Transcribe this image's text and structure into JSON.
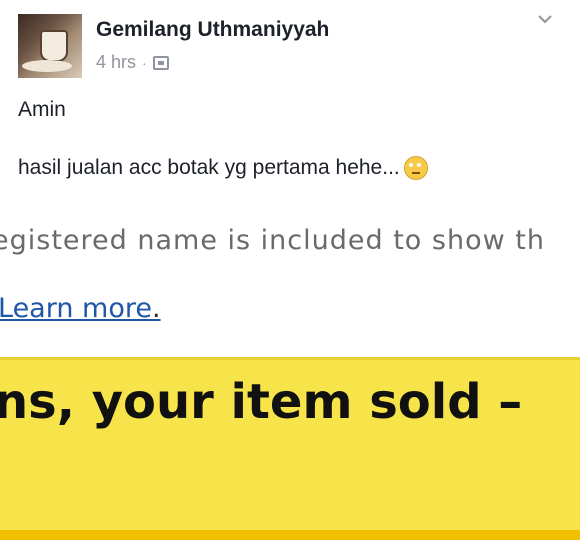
{
  "post": {
    "author": "Gemilang Uthmaniyyah",
    "time": "4 hrs",
    "separator": "·",
    "lines": [
      "Amin",
      "hasil jualan acc botak yg pertama hehe..."
    ]
  },
  "embedded_screenshot": {
    "registration_text": "egistered name is included to show th",
    "learn_more_link": "Learn more",
    "learn_more_suffix": ".",
    "banner_text": "ns, your item sold –"
  },
  "colors": {
    "banner": "#f6e44a",
    "link": "#1f57a8",
    "meta": "#90949c"
  },
  "icons": [
    "chevron-down-icon",
    "audience-icon",
    "emoji-icon"
  ]
}
